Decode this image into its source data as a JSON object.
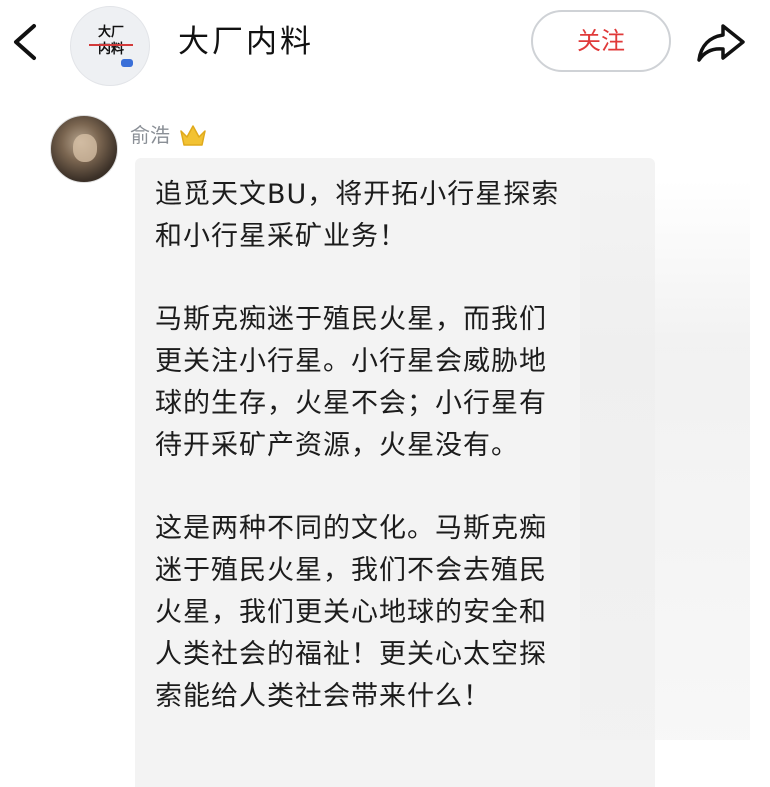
{
  "header": {
    "back_icon": "chevron-left-icon",
    "channel_avatar_text": "大厂\n内料",
    "channel_name": "大厂内料",
    "follow_label": "关注",
    "share_icon": "share-arrow-icon"
  },
  "post": {
    "author": "俞浩",
    "badge_icon": "crown-icon",
    "paragraphs": [
      [
        "追觅天文BU，将开拓小行星探索",
        "和小行星采矿业务！"
      ],
      [
        "马斯克痴迷于殖民火星，而我们",
        "更关注小行星。小行星会威胁地",
        "球的生存，火星不会；小行星有",
        "待开采矿产资源，火星没有。"
      ],
      [
        "这是两种不同的文化。马斯克痴",
        "迷于殖民火星，我们不会去殖民",
        "火星，我们更关心地球的安全和",
        "人类社会的福祉！更关心太空探",
        "索能给人类社会带来什么！"
      ]
    ]
  },
  "colors": {
    "follow_text": "#e03a3a",
    "bubble_bg": "#f3f3f3",
    "author_text": "#8a8f96",
    "badge": "#f2c233"
  }
}
